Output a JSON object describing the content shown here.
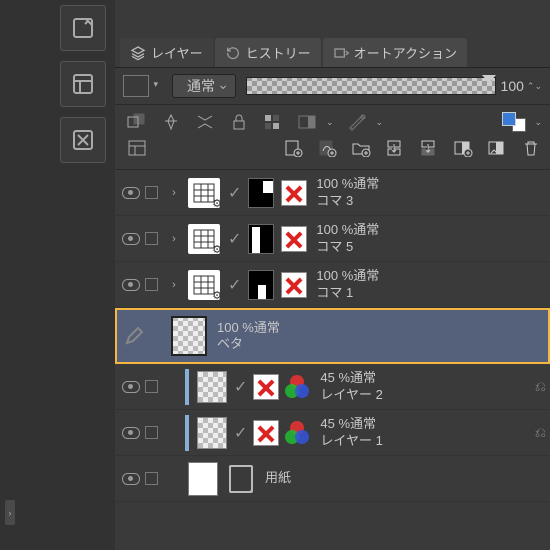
{
  "tabs": {
    "layers": "レイヤー",
    "history": "ヒストリー",
    "autoaction": "オートアクション"
  },
  "blend_mode": "通常",
  "opacity_value": "100",
  "layers_list": [
    {
      "opacity_mode": "100 %通常",
      "name": "コマ 3"
    },
    {
      "opacity_mode": "100 %通常",
      "name": "コマ 5"
    },
    {
      "opacity_mode": "100 %通常",
      "name": "コマ 1"
    },
    {
      "opacity_mode": "100 %通常",
      "name": "ベタ"
    },
    {
      "opacity_mode": "45 %通常",
      "name": "レイヤー 2"
    },
    {
      "opacity_mode": "45 %通常",
      "name": "レイヤー 1"
    },
    {
      "name": "用紙"
    }
  ]
}
